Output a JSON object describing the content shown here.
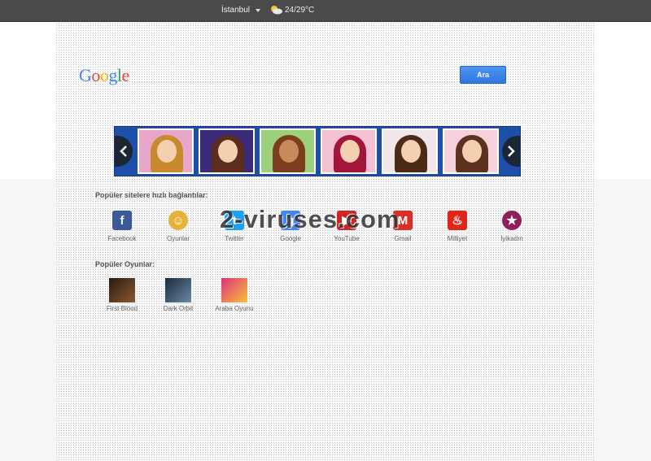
{
  "topbar": {
    "city": "İstanbul",
    "weather": "24/29°C"
  },
  "search": {
    "logo": "Google",
    "placeholder": "",
    "button_label": "Ara"
  },
  "carousel": {
    "thumbnails": 6
  },
  "popular_sites": {
    "title": "Popüler sitelere hızlı bağlantılar:",
    "items": [
      {
        "label": "Facebook",
        "icon": "facebook-icon",
        "color": "#3b5998"
      },
      {
        "label": "Oyunlar",
        "icon": "games-icon",
        "color": "#e8b23a"
      },
      {
        "label": "Twitter",
        "icon": "twitter-icon",
        "color": "#1da1f2"
      },
      {
        "label": "Google",
        "icon": "google-icon",
        "color": "#4285f4"
      },
      {
        "label": "YouTube",
        "icon": "youtube-icon",
        "color": "#d12424"
      },
      {
        "label": "Gmail",
        "icon": "gmail-icon",
        "color": "#d93025"
      },
      {
        "label": "Milliyet",
        "icon": "milliyet-icon",
        "color": "#e0261b"
      },
      {
        "label": "İyikadın",
        "icon": "iyikadin-icon",
        "color": "#8e1f5a"
      }
    ]
  },
  "popular_games": {
    "title": "Popüler Oyunlar:",
    "items": [
      {
        "label": "First Blood",
        "icon": "first-blood-icon"
      },
      {
        "label": "Dark Orbit",
        "icon": "dark-orbit-icon"
      },
      {
        "label": "Araba Oyunu",
        "icon": "car-game-icon"
      }
    ]
  },
  "watermark": "2-viruses.com"
}
